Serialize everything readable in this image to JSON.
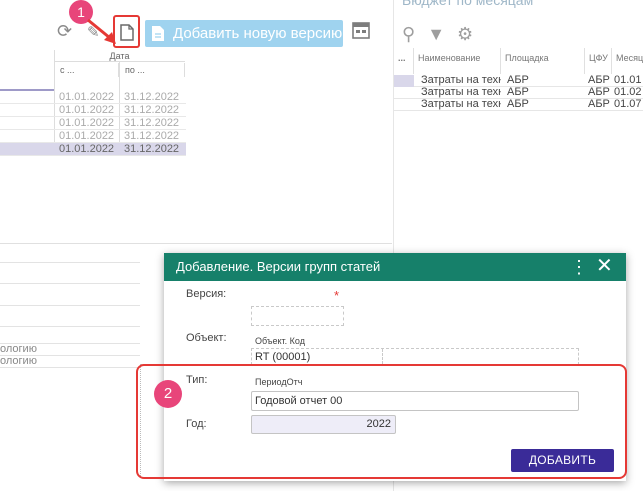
{
  "toolbar": {
    "add_version_label": "Добавить новую версию"
  },
  "badges": {
    "one": "1",
    "two": "2"
  },
  "left_grid": {
    "group_header": "Дата",
    "col_from": "с ...",
    "col_to": "по ...",
    "rows": [
      {
        "from": "01.01.2022",
        "to": "31.12.2022"
      },
      {
        "from": "01.01.2022",
        "to": "31.12.2022"
      },
      {
        "from": "01.01.2022",
        "to": "31.12.2022"
      },
      {
        "from": "01.01.2022",
        "to": "31.12.2022"
      },
      {
        "from": "01.01.2022",
        "to": "31.12.2022"
      }
    ]
  },
  "bottom_left": {
    "line1": "ологию",
    "line2": "ологию"
  },
  "right_pane": {
    "title": "Бюджет по месяцам",
    "columns": [
      "...",
      "Наименование",
      "Площадка",
      "ЦФУ",
      "Месяц"
    ],
    "rows": [
      {
        "name": "Затраты на техн",
        "site": "АБР",
        "cfu": "АБР",
        "month": "01.01"
      },
      {
        "name": "Затраты на техн",
        "site": "АБР",
        "cfu": "АБР",
        "month": "01.02"
      },
      {
        "name": "Затраты на техн",
        "site": "АБР",
        "cfu": "АБР",
        "month": "01.07"
      }
    ]
  },
  "dialog": {
    "title": "Добавление. Версии групп статей",
    "version_label": "Версия:",
    "required_mark": "*",
    "object_label": "Объект:",
    "object_subheader": "Объект. Код",
    "object_value": "RT (00001)",
    "type_label": "Тип:",
    "type_subheader": "ПериодОтч",
    "type_value": "Годовой отчет 00",
    "year_label": "Год:",
    "year_value": "2022",
    "add_button": "ДОБАВИТЬ"
  },
  "colors": {
    "header_green": "#16806a",
    "primary_button": "#3a2b98",
    "annotation_red": "#e53935",
    "badge_pink": "#e8457a",
    "add_version_bg": "#9fd3ef"
  }
}
